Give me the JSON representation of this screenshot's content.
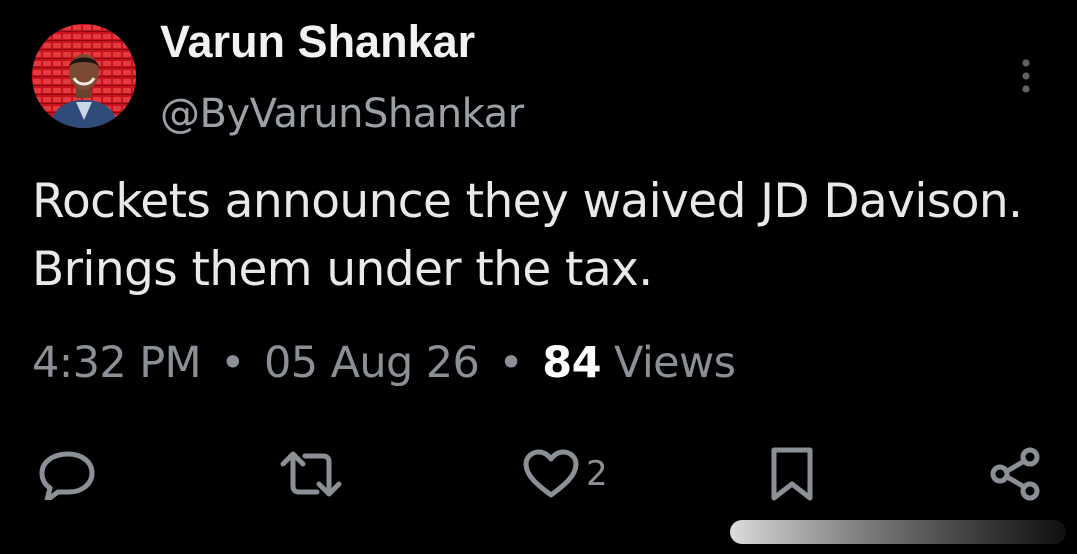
{
  "author": {
    "display_name": "Varun Shankar",
    "handle": "@ByVarunShankar",
    "avatar_icon": "profile-photo"
  },
  "tweet": {
    "text": "Rockets announce they waived JD Davison. Brings them under the tax.",
    "time": "4:32 PM",
    "separator": "•",
    "date": "05 Aug 26",
    "views_count": "84",
    "views_label": "Views"
  },
  "actions": {
    "reply_icon": "reply-icon",
    "retweet_icon": "retweet-icon",
    "like_icon": "heart-icon",
    "like_count": "2",
    "bookmark_icon": "bookmark-icon",
    "share_icon": "share-icon"
  },
  "colors": {
    "background": "#000000",
    "primary_text": "#e7e9ea",
    "secondary_text": "#8b9096",
    "icon": "#8b9096"
  }
}
